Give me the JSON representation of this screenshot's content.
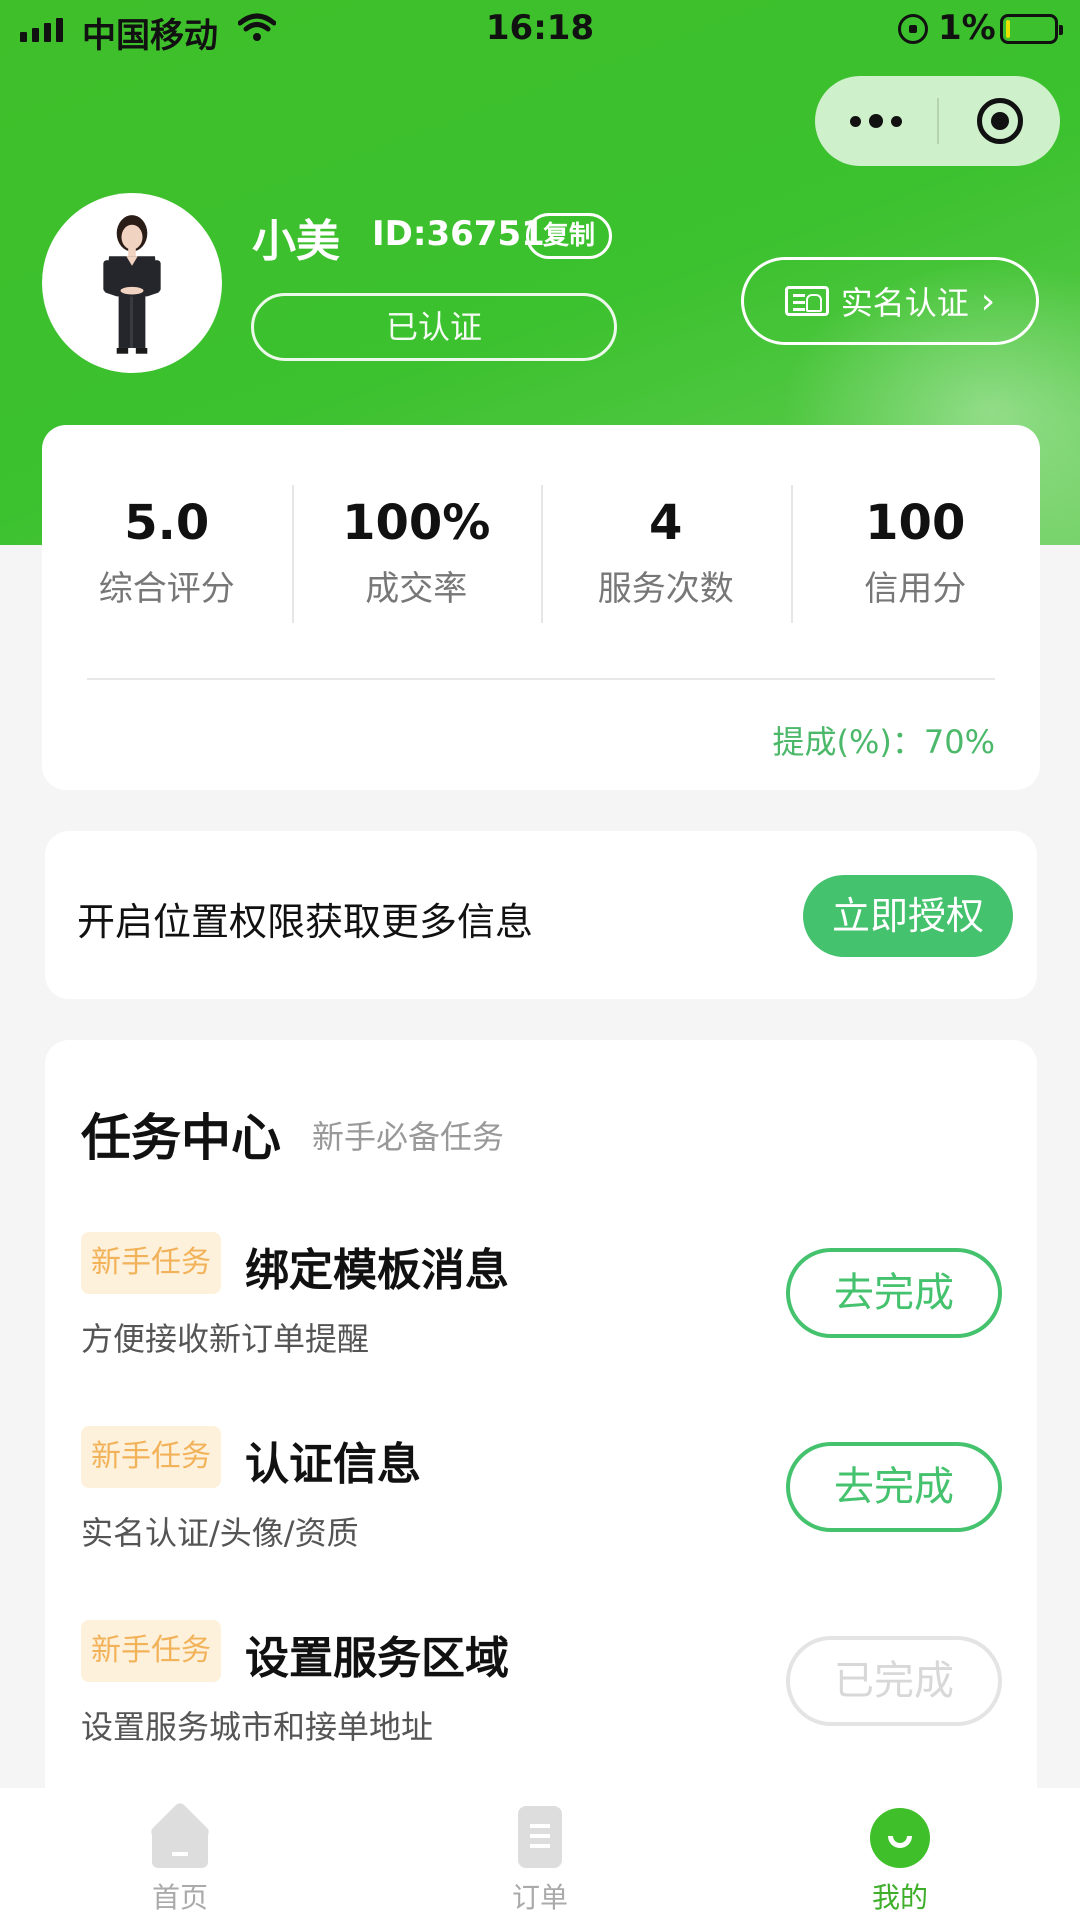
{
  "status_bar": {
    "carrier": "中国移动",
    "time": "16:18",
    "battery": "1%"
  },
  "profile": {
    "name": "小美",
    "id_text": "ID:36751",
    "copy_label": "复制",
    "verified_label": "已认证",
    "realname_label": "实名认证"
  },
  "stats": {
    "items": [
      {
        "value": "5.0",
        "label": "综合评分"
      },
      {
        "value": "100%",
        "label": "成交率"
      },
      {
        "value": "4",
        "label": "服务次数"
      },
      {
        "value": "100",
        "label": "信用分"
      }
    ],
    "commission": "提成(%)：70%"
  },
  "location": {
    "text": "开启位置权限获取更多信息",
    "button": "立即授权"
  },
  "tasks": {
    "title": "任务中心",
    "subtitle": "新手必备任务",
    "items": [
      {
        "tag": "新手任务",
        "name": "绑定模板消息",
        "desc": "方便接收新订单提醒",
        "action": "去完成"
      },
      {
        "tag": "新手任务",
        "name": "认证信息",
        "desc": "实名认证/头像/资质",
        "action": "去完成"
      },
      {
        "tag": "新手任务",
        "name": "设置服务区域",
        "desc": "设置服务城市和接单地址",
        "action": "已完成"
      }
    ]
  },
  "tabbar": {
    "items": [
      {
        "label": "首页"
      },
      {
        "label": "订单"
      },
      {
        "label": "我的"
      }
    ]
  },
  "colors": {
    "brand_green": "#3fbf2a",
    "action_green": "#45c26d",
    "tag_bg": "#fdf1db",
    "tag_text": "#f2b25a"
  }
}
